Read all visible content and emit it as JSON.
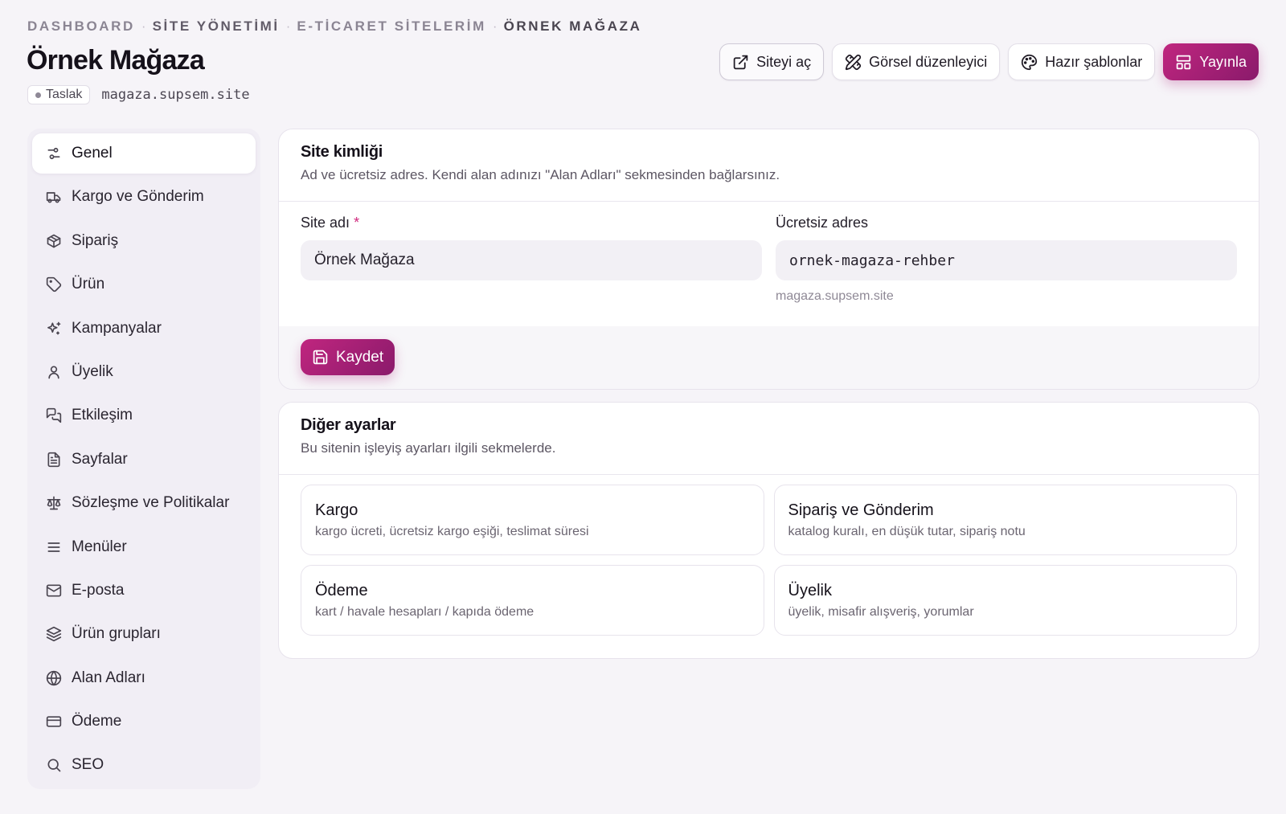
{
  "breadcrumb": {
    "items": [
      "DASHBOARD",
      "SİTE YÖNETİMİ",
      "E-TİCARET SİTELERİM",
      "ÖRNEK MAĞAZA"
    ],
    "separator": "·"
  },
  "header": {
    "title": "Örnek Mağaza",
    "status": "Taslak",
    "url": "magaza.supsem.site"
  },
  "actions": {
    "open_site": "Siteyi aç",
    "visual_editor": "Görsel düzenleyici",
    "templates": "Hazır şablonlar",
    "publish": "Yayınla"
  },
  "sidebar": {
    "items": [
      {
        "label": "Genel",
        "icon": "sliders-icon",
        "active": true
      },
      {
        "label": "Kargo ve Gönderim",
        "icon": "truck-icon"
      },
      {
        "label": "Sipariş",
        "icon": "package-icon"
      },
      {
        "label": "Ürün",
        "icon": "tag-icon"
      },
      {
        "label": "Kampanyalar",
        "icon": "sparkles-icon"
      },
      {
        "label": "Üyelik",
        "icon": "user-icon"
      },
      {
        "label": "Etkileşim",
        "icon": "messages-icon"
      },
      {
        "label": "Sayfalar",
        "icon": "file-text-icon"
      },
      {
        "label": "Sözleşme ve Politikalar",
        "icon": "scale-icon"
      },
      {
        "label": "Menüler",
        "icon": "menu-icon"
      },
      {
        "label": "E-posta",
        "icon": "mail-icon"
      },
      {
        "label": "Ürün grupları",
        "icon": "layers-icon"
      },
      {
        "label": "Alan Adları",
        "icon": "globe-icon"
      },
      {
        "label": "Ödeme",
        "icon": "credit-card-icon"
      },
      {
        "label": "SEO",
        "icon": "search-icon"
      }
    ]
  },
  "identity": {
    "title": "Site kimliği",
    "description": "Ad ve ücretsiz adres. Kendi alan adınızı \"Alan Adları\" sekmesinden bağlarsınız.",
    "site_name_label": "Site adı",
    "required_mark": "*",
    "site_name_value": "Örnek Mağaza",
    "free_address_label": "Ücretsiz adres",
    "free_address_value": "ornek-magaza-rehber",
    "free_address_hint": "magaza.supsem.site",
    "save_label": "Kaydet"
  },
  "other_settings": {
    "title": "Diğer ayarlar",
    "description": "Bu sitenin işleyiş ayarları ilgili sekmelerde.",
    "tiles": [
      {
        "title": "Kargo",
        "desc": "kargo ücreti, ücretsiz kargo eşiği, teslimat süresi"
      },
      {
        "title": "Sipariş ve Gönderim",
        "desc": "katalog kuralı, en düşük tutar, sipariş notu"
      },
      {
        "title": "Ödeme",
        "desc": "kart / havale hesapları / kapıda ödeme"
      },
      {
        "title": "Üyelik",
        "desc": "üyelik, misafir alışveriş, yorumlar"
      }
    ]
  },
  "colors": {
    "accent": "#b0217a",
    "accent_dark": "#8a1a6b",
    "background": "#f6f4f8"
  }
}
